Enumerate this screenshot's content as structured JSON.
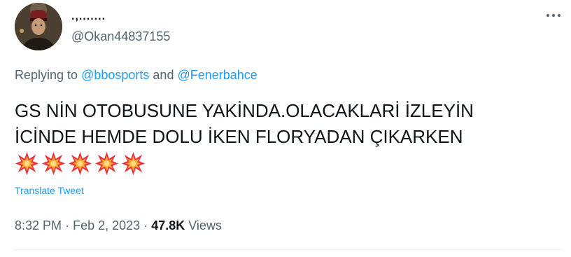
{
  "author": {
    "display_name": ".,.......",
    "handle": "@Okan44837155",
    "avatar_icon": "profile-photo"
  },
  "reply": {
    "prefix": "Replying to",
    "mention_1": "@bbosports",
    "joiner": "and",
    "mention_2": "@Fenerbahce"
  },
  "tweet": {
    "text": "GS NİN OTOBUSUNE YAKİNDA.OLACAKLARİ İZLEYİN\nİCİNDE HEMDE DOLU İKEN FLORYADAN ÇIKARKEN",
    "emojis": [
      "💥",
      "💥",
      "💥",
      "💥",
      "💥"
    ],
    "translate_label": "Translate Tweet"
  },
  "meta": {
    "time": "8:32 PM",
    "separator": "·",
    "date": "Feb 2, 2023",
    "views_count": "47.8K",
    "views_label": "Views"
  },
  "colors": {
    "link": "#1d9bf0",
    "secondary_text": "#536471",
    "primary_text": "#0f1419",
    "divider": "#eff3f4"
  }
}
